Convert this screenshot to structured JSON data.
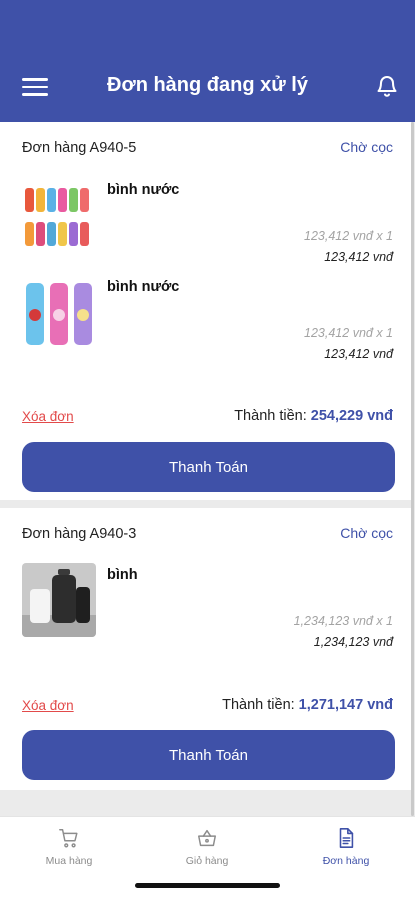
{
  "header": {
    "title": "Đơn hàng đang xử lý",
    "menu_icon": "hamburger-menu-icon",
    "bell_icon": "bell-icon"
  },
  "orders": [
    {
      "id": "Đơn hàng A940-5",
      "status": "Chờ cọc",
      "items": [
        {
          "name": "bình nước",
          "unit_price": "123,412 vnđ x 1",
          "line_total": "123,412 vnđ",
          "thumb": "colorful-bottles-thumbnail"
        },
        {
          "name": "bình nước",
          "unit_price": "123,412 vnđ x 1",
          "line_total": "123,412 vnđ",
          "thumb": "character-bottles-thumbnail"
        }
      ],
      "delete_label": "Xóa đơn",
      "total_label": "Thành tiền:",
      "total_value": "254,229 vnđ",
      "pay_label": "Thanh Toán"
    },
    {
      "id": "Đơn hàng A940-3",
      "status": "Chờ cọc",
      "items": [
        {
          "name": "bình",
          "unit_price": "1,234,123 vnđ x 1",
          "line_total": "1,234,123 vnđ",
          "thumb": "kettle-set-thumbnail"
        }
      ],
      "delete_label": "Xóa đơn",
      "total_label": "Thành tiền:",
      "total_value": "1,271,147 vnđ",
      "pay_label": "Thanh Toán"
    }
  ],
  "tabbar": {
    "tabs": [
      {
        "label": "Mua hàng",
        "icon": "shopping-cart-icon",
        "active": false
      },
      {
        "label": "Giỏ hàng",
        "icon": "basket-icon",
        "active": false
      },
      {
        "label": "Đơn hàng",
        "icon": "document-icon",
        "active": true
      }
    ]
  },
  "colors": {
    "primary": "#3f51a8",
    "danger": "#e24a4a",
    "background": "#ebebeb"
  }
}
